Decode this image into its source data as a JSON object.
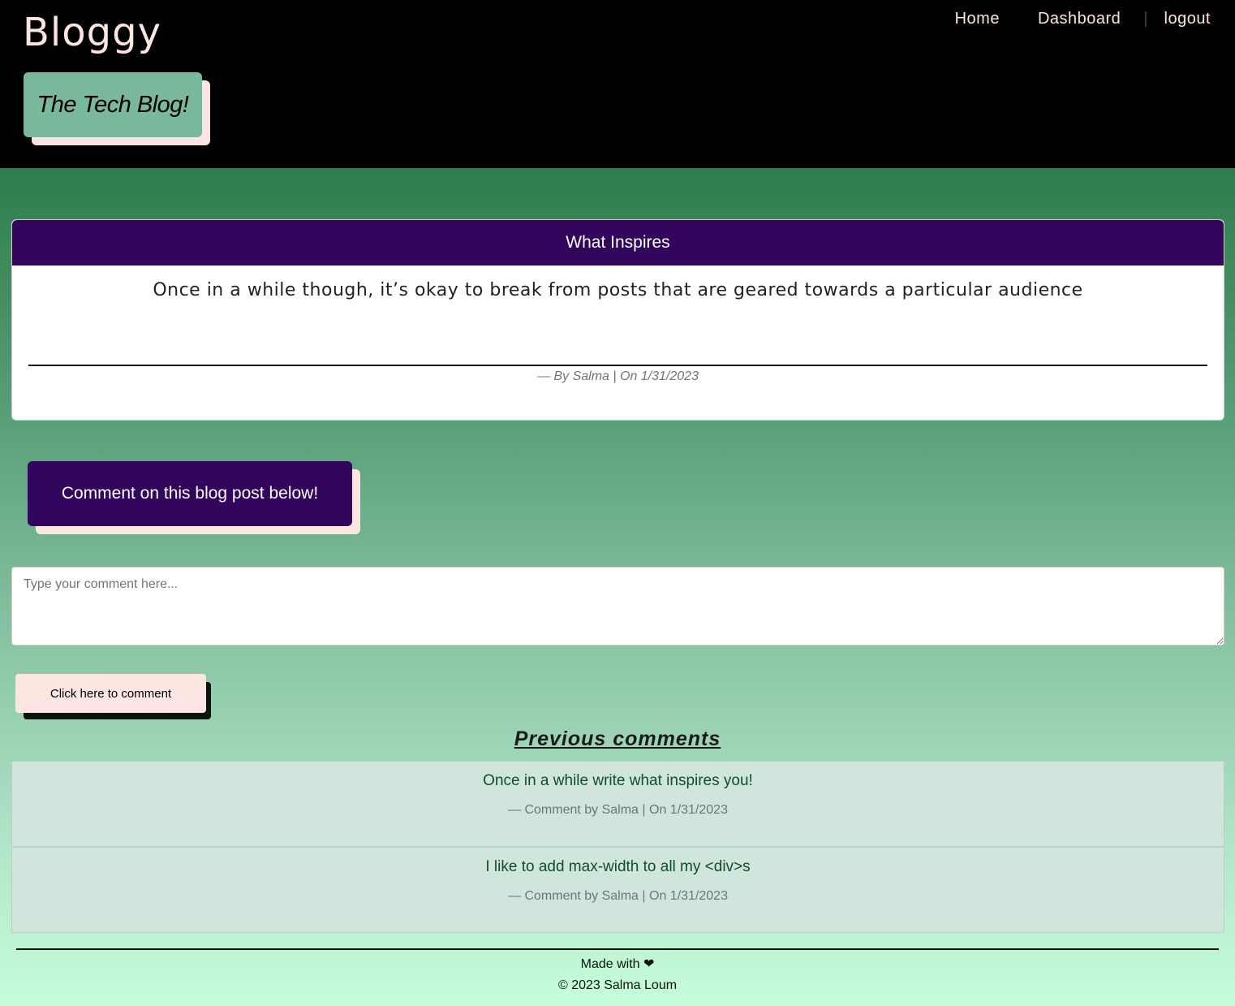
{
  "header": {
    "brand": "Bloggy",
    "tagline": "The Tech Blog!",
    "nav": {
      "home": "Home",
      "dashboard": "Dashboard",
      "separator": "|",
      "logout": "logout"
    }
  },
  "post": {
    "title": "What Inspires",
    "body": "Once in a while though, it’s okay to break from posts that are geared towards a particular audience",
    "meta": "—  By Salma | On 1/31/2023"
  },
  "comment_form": {
    "banner": "Comment on this blog post below!",
    "placeholder": "Type your comment here...",
    "submit_label": "Click here to comment"
  },
  "previous": {
    "heading": "Previous comments",
    "comments": [
      {
        "text": "Once in a while write what inspires you!",
        "meta": "— Comment by Salma | On 1/31/2023"
      },
      {
        "text": "I like to add max-width to all my <div>s",
        "meta": "— Comment by Salma | On 1/31/2023"
      }
    ]
  },
  "footer": {
    "made_with": "Made with ❤",
    "copyright": "© 2023 Salma Loum"
  },
  "colors": {
    "header_bg": "#000000",
    "brand": "#fde6e2",
    "accent_purple": "#33065e",
    "tagline_green": "#7ab89b"
  }
}
